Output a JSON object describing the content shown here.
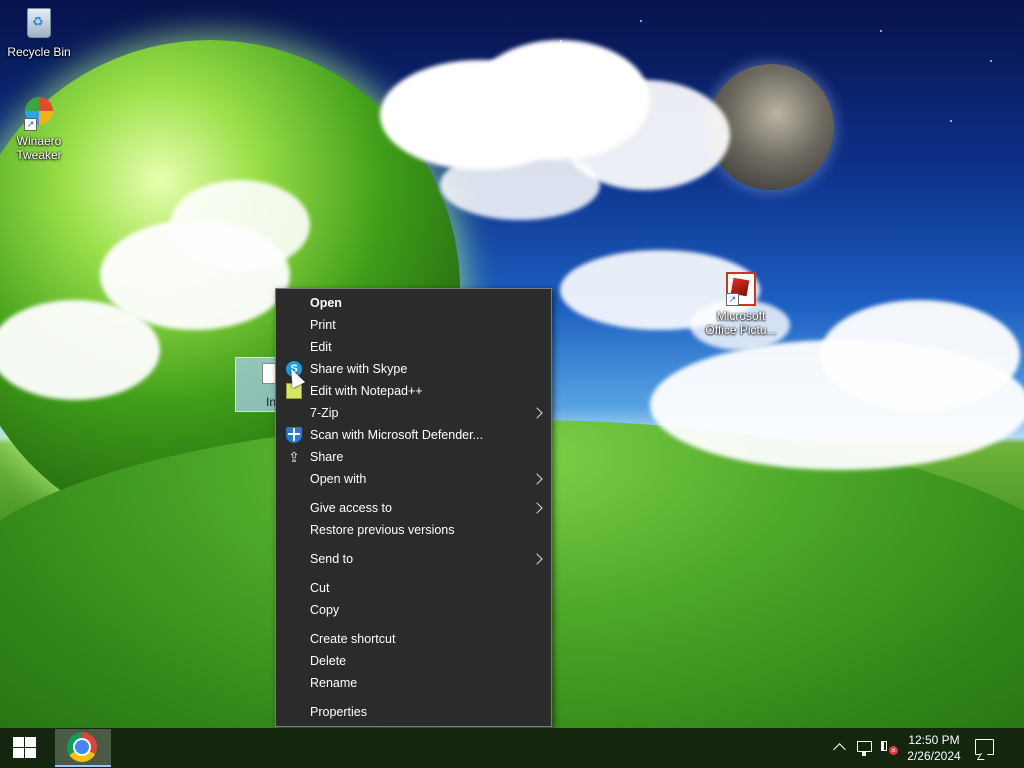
{
  "desktop": {
    "icons": [
      {
        "label": "Recycle Bin",
        "icon": "recycle-bin-icon"
      },
      {
        "label": "Winaero Tweaker",
        "icon": "winaero-tweaker-icon"
      },
      {
        "label": "Microsoft Office Pictu...",
        "icon": "office-picture-manager-icon"
      }
    ],
    "selected_file_label": "In"
  },
  "context_menu": {
    "items": [
      {
        "label": "Open",
        "bold": true
      },
      {
        "label": "Print"
      },
      {
        "label": "Edit"
      },
      {
        "label": "Share with Skype",
        "icon": "skype-icon"
      },
      {
        "label": "Edit with Notepad++",
        "icon": "notepad-plus-plus-icon"
      },
      {
        "label": "7-Zip",
        "submenu": true
      },
      {
        "label": "Scan with Microsoft Defender...",
        "icon": "defender-shield-icon"
      },
      {
        "label": "Share",
        "icon": "share-icon"
      },
      {
        "label": "Open with",
        "submenu": true
      },
      {
        "label": "Give access to",
        "submenu": true
      },
      {
        "label": "Restore previous versions"
      },
      {
        "label": "Send to",
        "submenu": true
      },
      {
        "label": "Cut"
      },
      {
        "label": "Copy"
      },
      {
        "label": "Create shortcut"
      },
      {
        "label": "Delete"
      },
      {
        "label": "Rename"
      },
      {
        "label": "Properties"
      }
    ]
  },
  "taskbar": {
    "start_icon": "windows-logo-icon",
    "pinned": [
      {
        "name": "Google Chrome",
        "icon": "chrome-icon"
      }
    ],
    "tray": {
      "time": "12:50 PM",
      "date": "2/26/2024",
      "icons": [
        "chevron-up-icon",
        "network-icon",
        "volume-muted-icon",
        "notification-icon"
      ]
    }
  }
}
